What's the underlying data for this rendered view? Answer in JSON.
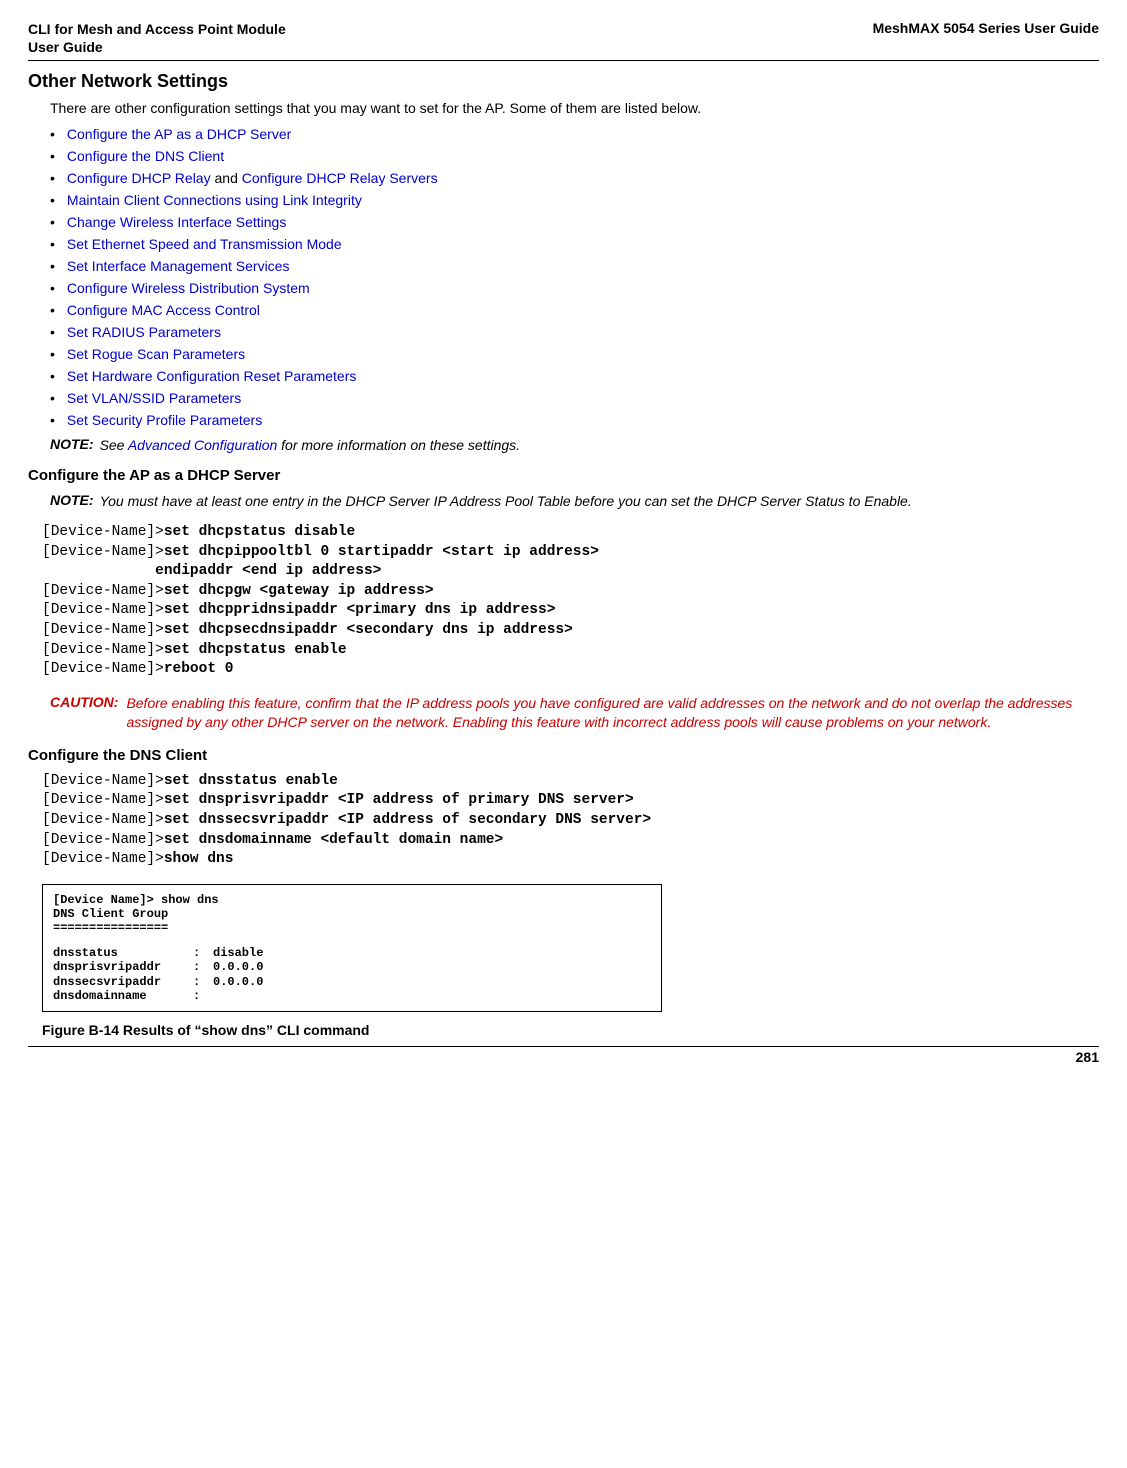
{
  "header": {
    "left_line1": "CLI for Mesh and Access Point Module",
    "left_line2": " User Guide",
    "right": "MeshMAX 5054 Series User Guide"
  },
  "section": {
    "title": "Other Network Settings",
    "intro": "There are other configuration settings that you may want to set for the AP. Some of them are listed below."
  },
  "links": [
    "Configure the AP as a DHCP Server",
    "Configure the DNS Client",
    "Configure DHCP Relay",
    "Configure DHCP Relay Servers",
    "Maintain Client Connections using Link Integrity",
    "Change Wireless Interface Settings",
    "Set Ethernet Speed and Transmission Mode",
    "Set Interface Management Services",
    "Configure Wireless Distribution System",
    "Configure MAC Access Control",
    "Set RADIUS Parameters",
    "Set Rogue Scan Parameters",
    "Set Hardware Configuration Reset Parameters",
    "Set VLAN/SSID Parameters",
    "Set Security Profile Parameters"
  ],
  "link_and": " and ",
  "note1": {
    "label": "NOTE:",
    "text_before": "See ",
    "link": "Advanced Configuration",
    "text_after": " for more information on these settings."
  },
  "sub1_heading": "Configure the AP as a DHCP Server",
  "note2": {
    "label": "NOTE:",
    "text": "You must have at least one entry in the DHCP Server IP Address Pool Table before you can set the DHCP Server Status to Enable."
  },
  "code1": {
    "p1": "[Device-Name]>",
    "c1": "set dhcpstatus disable",
    "p2": "[Device-Name]>",
    "c2": "set dhcpippooltbl 0 startipaddr <start ip address>",
    "c2b": "             endipaddr <end ip address>",
    "p3": "[Device-Name]>",
    "c3": "set dhcpgw <gateway ip address>",
    "p4": "[Device-Name]>",
    "c4": "set dhcppridnsipaddr <primary dns ip address>",
    "p5": "[Device-Name]>",
    "c5": "set dhcpsecdnsipaddr <secondary dns ip address>",
    "p6": "[Device-Name]>",
    "c6": "set dhcpstatus enable",
    "p7": "[Device-Name]>",
    "c7": "reboot 0"
  },
  "caution": {
    "label": "CAUTION:",
    "text": "Before enabling this feature, confirm that the IP address pools you have configured are valid addresses on the network and do not overlap the addresses assigned by any other DHCP server on the network. Enabling this feature with incorrect address pools will cause problems on your network."
  },
  "sub2_heading": "Configure the DNS Client",
  "code2": {
    "p1": "[Device-Name]>",
    "c1": "set dnsstatus enable",
    "p2": "[Device-Name]>",
    "c2": "set dnsprisvripaddr <IP address of primary DNS server>",
    "p3": "[Device-Name]>",
    "c3": "set dnssecsvripaddr <IP address of secondary DNS server>",
    "p4": "[Device-Name]>",
    "c4": "set dnsdomainname <default domain name>",
    "p5": "[Device-Name]>",
    "c5": "show dns"
  },
  "screenshot": {
    "line1": "[Device Name]> show dns",
    "line2": "DNS Client Group",
    "line3": "================",
    "rows": [
      {
        "k": "dnsstatus",
        "c": ":",
        "v": "disable"
      },
      {
        "k": "dnsprisvripaddr",
        "c": ":",
        "v": "0.0.0.0"
      },
      {
        "k": "dnssecsvripaddr",
        "c": ":",
        "v": "0.0.0.0"
      },
      {
        "k": "dnsdomainname",
        "c": ":",
        "v": ""
      }
    ]
  },
  "figure_caption": "Figure B-14 Results of “show dns” CLI command",
  "page_number": "281"
}
